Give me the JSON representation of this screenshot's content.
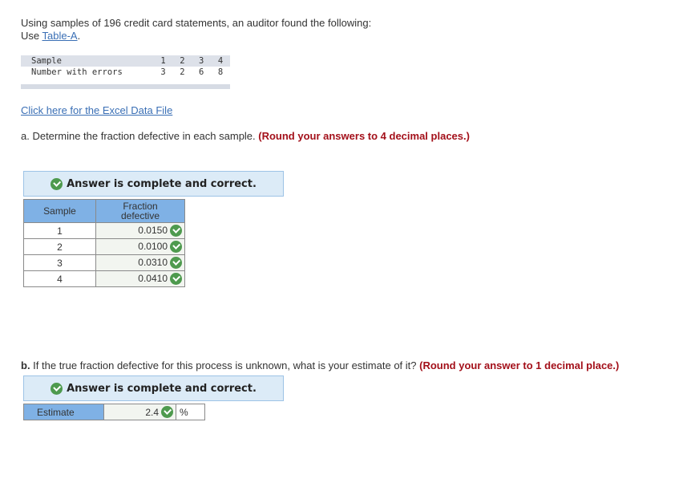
{
  "intro": {
    "text": "Using samples of 196 credit card statements, an auditor found the following:",
    "use_prefix": "Use ",
    "table_link": "Table-A",
    "use_suffix": "."
  },
  "data_table": {
    "row_labels": [
      "Sample",
      "Number with errors"
    ],
    "samples": [
      "1",
      "2",
      "3",
      "4"
    ],
    "errors": [
      "3",
      "2",
      "6",
      "8"
    ]
  },
  "excel_link": "Click here for the Excel Data File",
  "part_a": {
    "prompt": "a. Determine the fraction defective in each sample. ",
    "instruction": "(Round your answers to 4 decimal places.)",
    "banner": "Answer is complete and correct.",
    "headers": [
      "Sample",
      "Fraction defective"
    ],
    "rows": [
      {
        "sample": "1",
        "value": "0.0150",
        "status": "correct"
      },
      {
        "sample": "2",
        "value": "0.0100",
        "status": "correct"
      },
      {
        "sample": "3",
        "value": "0.0310",
        "status": "correct"
      },
      {
        "sample": "4",
        "value": "0.0410",
        "status": "correct"
      }
    ]
  },
  "part_b": {
    "label": "b.",
    "prompt": " If the true fraction defective for this process is unknown, what is your estimate of it? ",
    "instruction": "(Round your answer to 1 decimal place.)",
    "banner": "Answer is complete and correct.",
    "estimate_label": "Estimate",
    "estimate_value": "2.4",
    "estimate_unit": "%",
    "status": "correct"
  },
  "colors": {
    "link": "#3a6fb5",
    "instruction_red": "#a3101a",
    "banner_bg": "#dcebf7",
    "header_blue": "#7fb1e5",
    "check_green": "#4e9a4e"
  }
}
